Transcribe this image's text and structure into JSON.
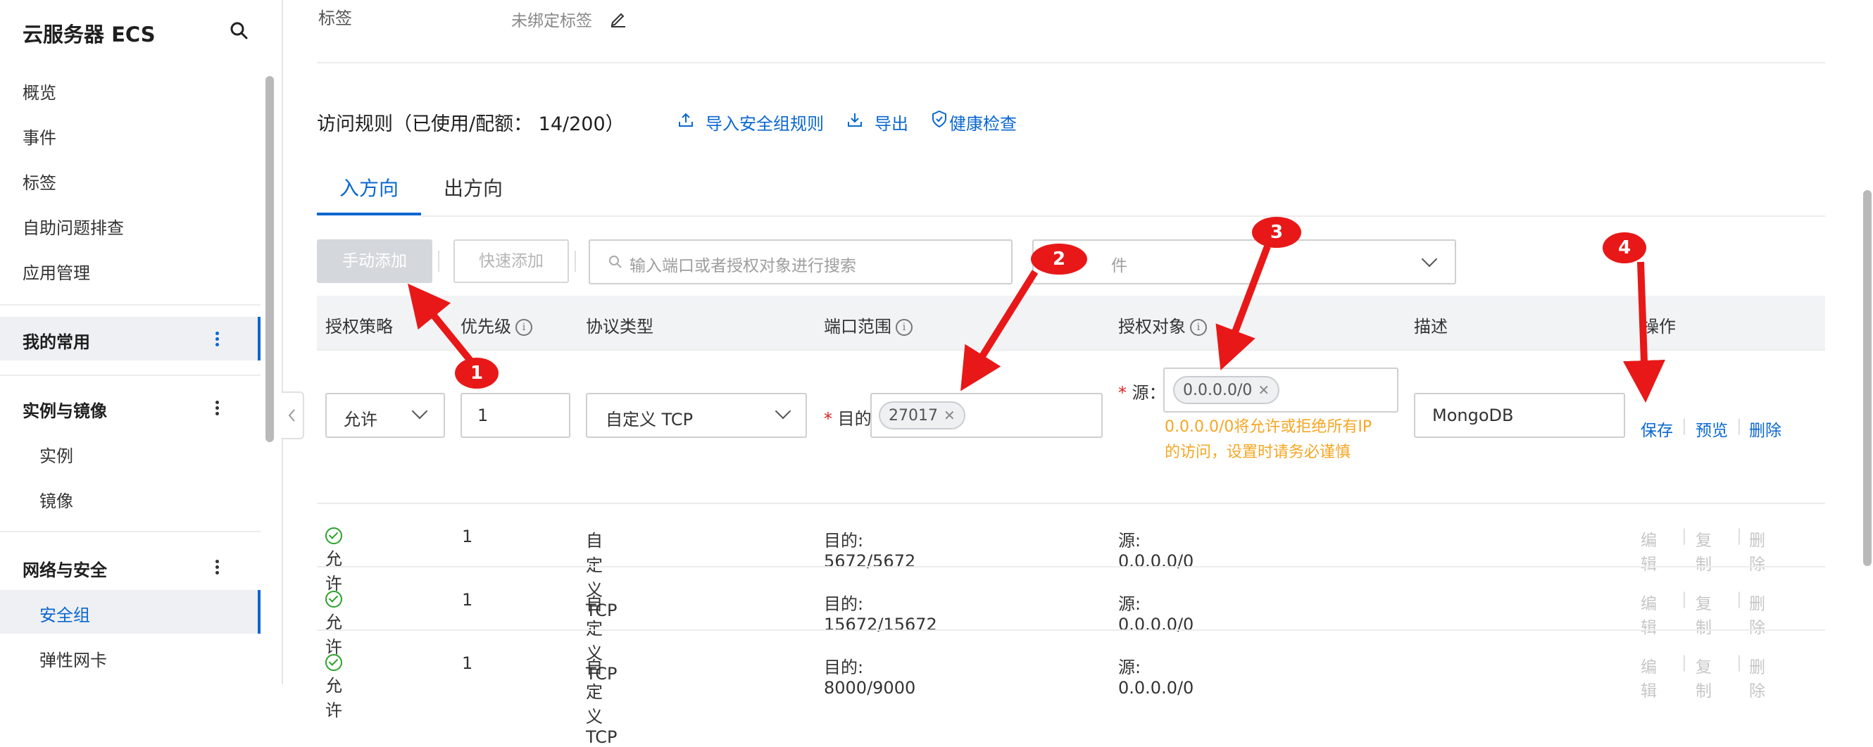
{
  "sidebar": {
    "title": "云服务器 ECS",
    "items": [
      "概览",
      "事件",
      "标签",
      "自助问题排查",
      "应用管理"
    ],
    "favorites": "我的常用",
    "group_instances": {
      "title": "实例与镜像",
      "items": [
        "实例",
        "镜像"
      ]
    },
    "group_network": {
      "title": "网络与安全",
      "items": [
        "安全组",
        "弹性网卡"
      ]
    }
  },
  "top": {
    "tag_label": "标签",
    "tag_value": "未绑定标签"
  },
  "rules": {
    "title": "访问规则（已使用/配额： 14/200）",
    "import_link": "导入安全组规则",
    "export_link": "导出",
    "health_link": "健康检查"
  },
  "tabs": [
    "入方向",
    "出方向"
  ],
  "toolbar": {
    "manual_add": "手动添加",
    "quick_add": "快速添加",
    "search_placeholder": "输入端口或者授权对象进行搜索",
    "filter_placeholder": "件"
  },
  "columns": [
    "授权策略",
    "优先级",
    "协议类型",
    "端口范围",
    "授权对象",
    "描述",
    "操作"
  ],
  "edit_row": {
    "policy": "允许",
    "priority": "1",
    "protocol": "自定义 TCP",
    "port_prefix": "目的",
    "port_chip": "27017",
    "source_prefix": "源：",
    "source_chip": "0.0.0.0/0",
    "warning_line1": "0.0.0.0/0将允许或拒绝所有IP",
    "warning_line2": "的访问，设置时请务必谨慎",
    "description": "MongoDB",
    "actions": [
      "保存",
      "预览",
      "删除"
    ]
  },
  "rows": [
    {
      "policy": "允许",
      "priority": "1",
      "protocol": "自定义 TCP",
      "port": "目的: 5672/5672",
      "source": "源: 0.0.0.0/0"
    },
    {
      "policy": "允许",
      "priority": "1",
      "protocol": "自定义 TCP",
      "port": "目的: 15672/15672",
      "source": "源: 0.0.0.0/0"
    },
    {
      "policy": "允许",
      "priority": "1",
      "protocol": "自定义 TCP",
      "port": "目的: 8000/9000",
      "source": "源: 0.0.0.0/0"
    }
  ],
  "row_actions": [
    "编辑",
    "复制",
    "删除"
  ],
  "annotations": [
    "1",
    "2",
    "3",
    "4"
  ],
  "colors": {
    "accent": "#0a67d1",
    "annotation_red": "#e81818",
    "warning": "#f5a623",
    "ok_green": "#29a329"
  }
}
